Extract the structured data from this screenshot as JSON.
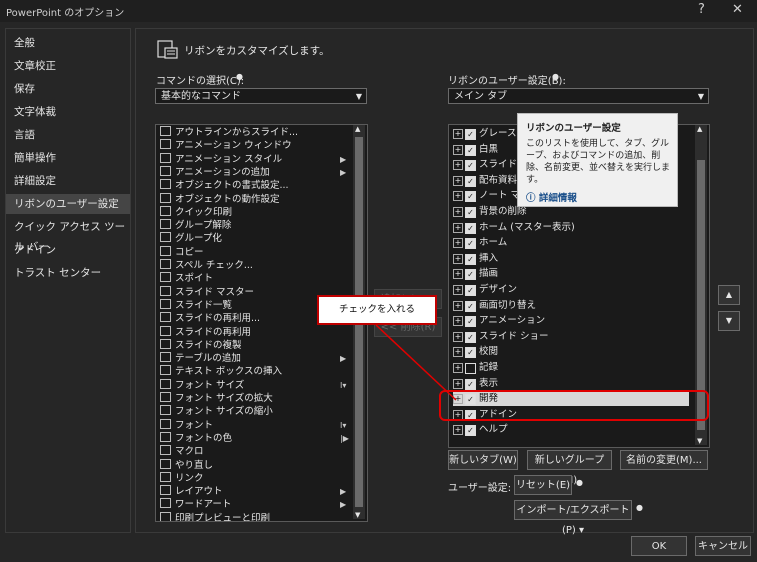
{
  "window": {
    "title": "PowerPoint のオプション",
    "help": "?",
    "close": "✕"
  },
  "nav": [
    "全般",
    "文章校正",
    "保存",
    "文字体裁",
    "言語",
    "簡単操作",
    "詳細設定",
    "リボンのユーザー設定",
    "クイック アクセス ツール バー",
    "アドイン",
    "トラスト センター"
  ],
  "nav_selected": 7,
  "header": {
    "title": "リボンをカスタマイズします。"
  },
  "left": {
    "label": "コマンドの選択(C):",
    "combo_value": "基本的なコマンド",
    "items": [
      {
        "label": "アウトラインからスライド...",
        "sub": ""
      },
      {
        "label": "アニメーション ウィンドウ",
        "sub": ""
      },
      {
        "label": "アニメーション スタイル",
        "sub": "▶"
      },
      {
        "label": "アニメーションの追加",
        "sub": "▶"
      },
      {
        "label": "オブジェクトの書式設定...",
        "sub": ""
      },
      {
        "label": "オブジェクトの動作設定",
        "sub": ""
      },
      {
        "label": "クイック印刷",
        "sub": ""
      },
      {
        "label": "グループ解除",
        "sub": ""
      },
      {
        "label": "グループ化",
        "sub": ""
      },
      {
        "label": "コピー",
        "sub": ""
      },
      {
        "label": "スペル チェック...",
        "sub": ""
      },
      {
        "label": "スポイト",
        "sub": ""
      },
      {
        "label": "スライド マスター",
        "sub": ""
      },
      {
        "label": "スライド一覧",
        "sub": ""
      },
      {
        "label": "スライドの再利用...",
        "sub": ""
      },
      {
        "label": "スライドの再利用",
        "sub": ""
      },
      {
        "label": "スライドの複製",
        "sub": ""
      },
      {
        "label": "テーブルの追加",
        "sub": "▶"
      },
      {
        "label": "テキスト ボックスの挿入",
        "sub": ""
      },
      {
        "label": "フォント サイズ",
        "sub": "I▾"
      },
      {
        "label": "フォント サイズの拡大",
        "sub": ""
      },
      {
        "label": "フォント サイズの縮小",
        "sub": ""
      },
      {
        "label": "フォント",
        "sub": "I▾"
      },
      {
        "label": "フォントの色",
        "sub": "|▶"
      },
      {
        "label": "マクロ",
        "sub": ""
      },
      {
        "label": "やり直し",
        "sub": ""
      },
      {
        "label": "リンク",
        "sub": ""
      },
      {
        "label": "レイアウト",
        "sub": "▶"
      },
      {
        "label": "ワードアート",
        "sub": "▶"
      },
      {
        "label": "印刷プレビューと印刷",
        "sub": ""
      }
    ]
  },
  "right": {
    "label": "リボンのユーザー設定(B):",
    "combo_value": "メイン タブ",
    "items": [
      {
        "label": "グレースケール",
        "checked": true
      },
      {
        "label": "白黒",
        "checked": true
      },
      {
        "label": "スライド マスター",
        "checked": true
      },
      {
        "label": "配布資料マスター",
        "checked": true
      },
      {
        "label": "ノート マスター",
        "checked": true
      },
      {
        "label": "背景の削除",
        "checked": true
      },
      {
        "label": "ホーム (マスター表示)",
        "checked": true
      },
      {
        "label": "ホーム",
        "checked": true
      },
      {
        "label": "挿入",
        "checked": true
      },
      {
        "label": "描画",
        "checked": true
      },
      {
        "label": "デザイン",
        "checked": true
      },
      {
        "label": "画面切り替え",
        "checked": true
      },
      {
        "label": "アニメーション",
        "checked": true
      },
      {
        "label": "スライド ショー",
        "checked": true
      },
      {
        "label": "校閲",
        "checked": true
      },
      {
        "label": "記録",
        "checked": false
      },
      {
        "label": "表示",
        "checked": true
      },
      {
        "label": "開発",
        "checked": true
      },
      {
        "label": "アドイン",
        "checked": true
      },
      {
        "label": "ヘルプ",
        "checked": true
      }
    ]
  },
  "tooltip": {
    "title": "リボンのユーザー設定",
    "body": "このリストを使用して、タブ、グループ、およびコマンドの追加、削除、名前変更、並べ替えを実行します。",
    "link": "詳細情報"
  },
  "callout": "チェックを入れる",
  "middle": {
    "add": "追加(A) >>",
    "remove": "<< 削除(R)"
  },
  "buttons": {
    "new_tab": "新しいタブ(W)",
    "new_group": "新しいグループ(N)",
    "rename": "名前の変更(M)...",
    "user_settings_label": "ユーザー設定:",
    "reset": "リセット(E) ▾",
    "import_export": "インポート/エクスポート(P) ▾",
    "ok": "OK",
    "cancel": "キャンセル"
  },
  "colors": {
    "highlight": "#e00000",
    "selection": "#454545",
    "link": "#1a4f8a"
  }
}
